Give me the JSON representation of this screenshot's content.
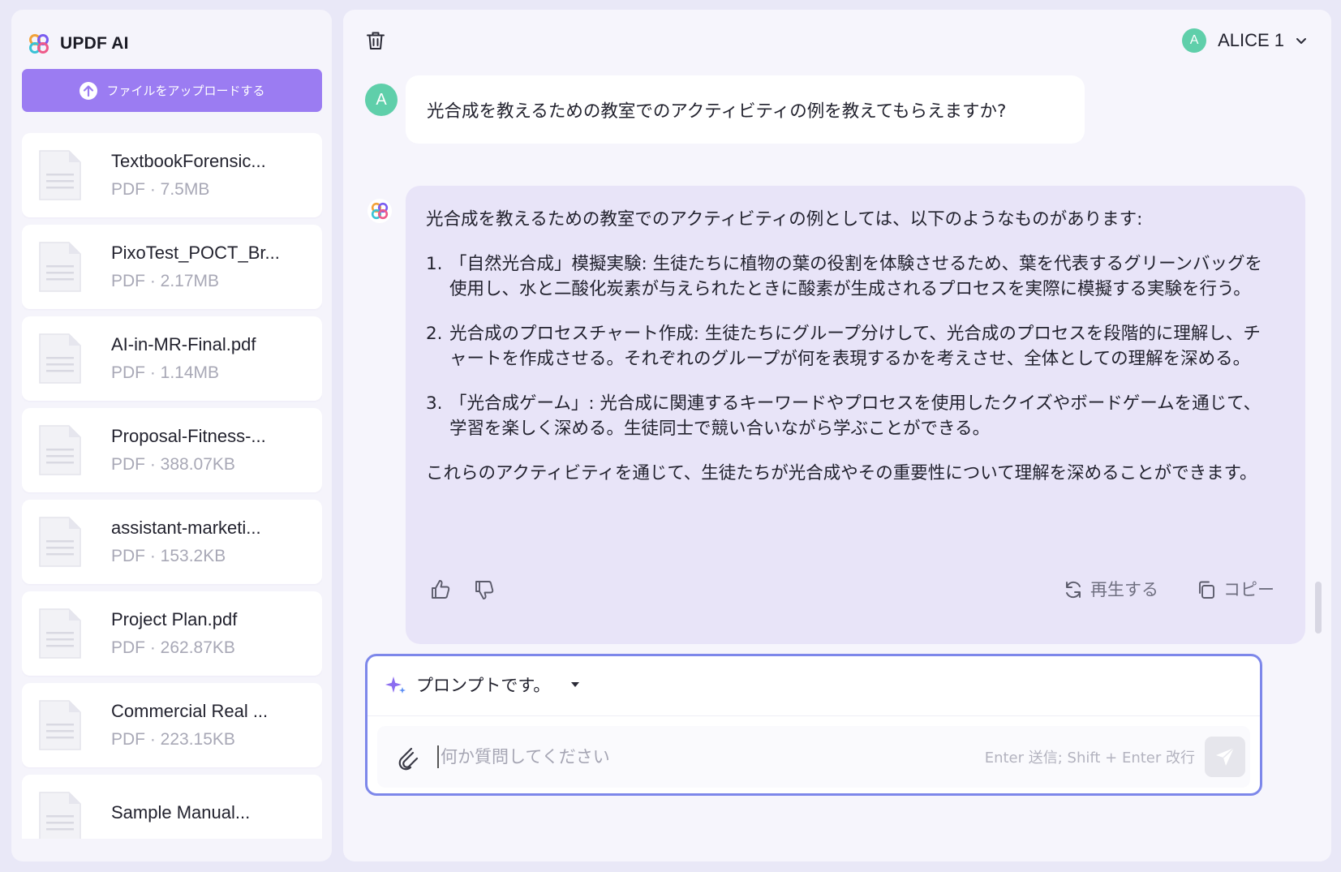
{
  "app": {
    "brand": "UPDF AI",
    "colors": {
      "accent": "#9b7cf2",
      "ai_bubble": "#e8e4f8",
      "avatar": "#5fcfaa",
      "composer_border": "#7d87ea"
    }
  },
  "sidebar": {
    "upload_label": "ファイルをアップロードする",
    "files": [
      {
        "name": "TextbookForensic...",
        "info": "PDF · 7.5MB"
      },
      {
        "name": "PixoTest_POCT_Br...",
        "info": "PDF · 2.17MB"
      },
      {
        "name": "AI-in-MR-Final.pdf",
        "info": "PDF · 1.14MB"
      },
      {
        "name": "Proposal-Fitness-...",
        "info": "PDF · 388.07KB"
      },
      {
        "name": "assistant-marketi...",
        "info": "PDF · 153.2KB"
      },
      {
        "name": "Project Plan.pdf",
        "info": "PDF · 262.87KB"
      },
      {
        "name": "Commercial Real ...",
        "info": "PDF · 223.15KB"
      },
      {
        "name": "Sample Manual...",
        "info": ""
      }
    ]
  },
  "header": {
    "user_initial": "A",
    "user_name": "ALICE 1"
  },
  "conversation": {
    "user_initial": "A",
    "user_message": "光合成を教えるための教室でのアクティビティの例を教えてもらえますか?",
    "ai_intro": "光合成を教えるための教室でのアクティビティの例としては、以下のようなものがあります:",
    "ai_items": [
      {
        "num": "1.",
        "text": "「自然光合成」模擬実験: 生徒たちに植物の葉の役割を体験させるため、葉を代表するグリーンバッグを使用し、水と二酸化炭素が与えられたときに酸素が生成されるプロセスを実際に模擬する実験を行う。"
      },
      {
        "num": "2.",
        "text": "光合成のプロセスチャート作成: 生徒たちにグループ分けして、光合成のプロセスを段階的に理解し、チャートを作成させる。それぞれのグループが何を表現するかを考えさせ、全体としての理解を深める。"
      },
      {
        "num": "3.",
        "text": "「光合成ゲーム」: 光合成に関連するキーワードやプロセスを使用したクイズやボードゲームを通じて、学習を楽しく深める。生徒同士で競い合いながら学ぶことができる。"
      }
    ],
    "ai_outro": "これらのアクティビティを通じて、生徒たちが光合成やその重要性について理解を深めることができます。",
    "regenerate_label": "再生する",
    "copy_label": "コピー"
  },
  "composer": {
    "prompt_label": "プロンプトです。",
    "placeholder": "何か質問してください",
    "hint": "Enter 送信; Shift + Enter 改行"
  }
}
